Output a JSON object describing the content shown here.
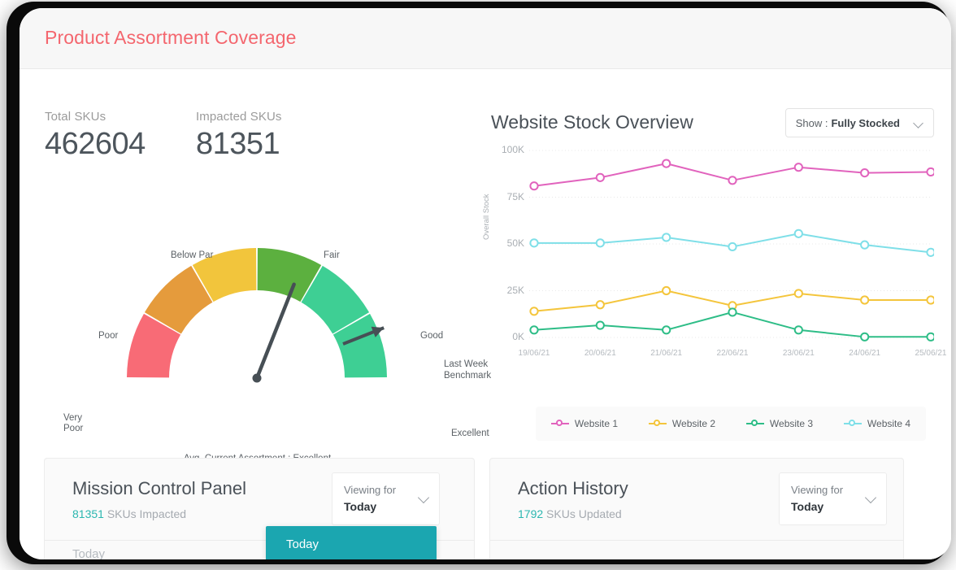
{
  "header": {
    "title": "Product Assortment Coverage",
    "accent": "#f4666e"
  },
  "kpis": [
    {
      "label": "Total SKUs",
      "value": "462604"
    },
    {
      "label": "Impacted SKUs",
      "value": "81351"
    }
  ],
  "gauge": {
    "caption": "Avg. Current Assortment : Excellent",
    "current_value": "Excellent",
    "benchmark_label": "Last Week\nBenchmark",
    "segments": [
      {
        "label": "Very\nPoor",
        "color": "#f86b76"
      },
      {
        "label": "Poor",
        "color": "#e59b3c"
      },
      {
        "label": "Below Par",
        "color": "#f2c53c"
      },
      {
        "label": "Fair",
        "color": "#5cb03f"
      },
      {
        "label": "Good",
        "color": "#3ecf94"
      },
      {
        "label": "Excellent",
        "color": "#3ecf94"
      }
    ],
    "needle_value_pct": 62,
    "benchmark_value_pct": 88
  },
  "chart_panel": {
    "title": "Website Stock Overview",
    "filter": {
      "prefix": "Show :",
      "value": "Fully Stocked",
      "icon": "chevron-down-icon"
    }
  },
  "chart_data": {
    "type": "line",
    "title": "Website Stock Overview",
    "xlabel": "",
    "ylabel": "Overall Stock",
    "categories": [
      "19/06/21",
      "20/06/21",
      "21/06/21",
      "22/06/21",
      "23/06/21",
      "24/06/21",
      "25/06/21"
    ],
    "yticks": [
      "0K",
      "25K",
      "50K",
      "75K",
      "100K"
    ],
    "ylim": [
      0,
      100000
    ],
    "grid": true,
    "legend_position": "bottom",
    "series": [
      {
        "name": "Website 1",
        "color": "#e163bd",
        "values": [
          81000,
          85500,
          93000,
          84000,
          91000,
          88000,
          88500
        ]
      },
      {
        "name": "Website 2",
        "color": "#f4c53c",
        "values": [
          14000,
          17500,
          25000,
          17000,
          23500,
          20000,
          20000
        ]
      },
      {
        "name": "Website 3",
        "color": "#2ebd87",
        "values": [
          4000,
          6500,
          4000,
          13500,
          4000,
          300,
          300
        ]
      },
      {
        "name": "Website 4",
        "color": "#7fdfe8",
        "values": [
          50500,
          50500,
          53500,
          48500,
          55500,
          49500,
          45500
        ]
      }
    ]
  },
  "mission_panel": {
    "title": "Mission Control Panel",
    "count": "81351",
    "count_suffix": "SKUs Impacted",
    "viewing_label": "Viewing for",
    "viewing_value": "Today",
    "row_label": "Today",
    "dropdown_open_option": "Today",
    "accent": "#1ba6b0"
  },
  "action_panel": {
    "title": "Action History",
    "count": "1792",
    "count_suffix": "SKUs Updated",
    "viewing_label": "Viewing for",
    "viewing_value": "Today"
  }
}
